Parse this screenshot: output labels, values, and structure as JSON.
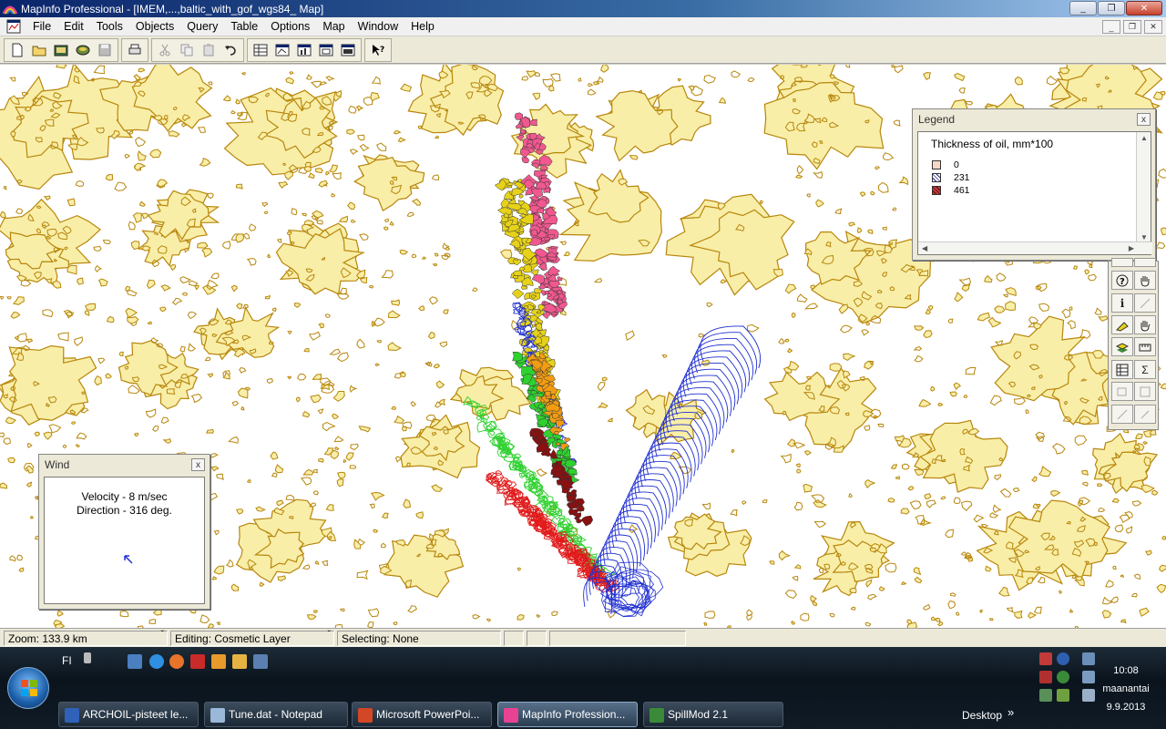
{
  "window": {
    "title": "MapInfo Professional - [IMEM,...,baltic_with_gof_wgs84_ Map]",
    "minimize": "_",
    "restore": "❐",
    "close": "✕"
  },
  "menubar": {
    "items": [
      "File",
      "Edit",
      "Tools",
      "Objects",
      "Query",
      "Table",
      "Options",
      "Map",
      "Window",
      "Help"
    ]
  },
  "toolbar": {
    "icons": [
      "new-icon",
      "open-icon",
      "open-workspace-icon",
      "open-dbms-icon",
      "save-icon",
      "print-icon",
      "cut-icon",
      "copy-icon",
      "paste-icon",
      "undo-icon",
      "new-browser-icon",
      "new-mapper-icon",
      "new-grapher-icon",
      "new-layout-icon",
      "redistrict-icon",
      "help-pointer-icon"
    ]
  },
  "colors": {
    "land": "#f8eea8",
    "coast": "#b8860b",
    "oil_yellow": "#e7d21a",
    "oil_pink": "#f0588f",
    "oil_blue": "#1f2fd0",
    "oil_green": "#2fd12f",
    "oil_red": "#e11b1b",
    "oil_orange": "#f39c12"
  },
  "wind": {
    "title": "Wind",
    "velocity": "Velocity - 8 m/sec",
    "direction": "Direction - 316 deg.",
    "close": "x"
  },
  "legend": {
    "title": "Legend",
    "heading": "Thickness of oil, mm*100",
    "close": "x",
    "entries": [
      {
        "label": "0",
        "color": "#f7d8c8"
      },
      {
        "label": "231",
        "color": "#ffffff"
      },
      {
        "label": "461",
        "color": "#c23a3a"
      }
    ]
  },
  "palette": {
    "icons": [
      "zoom-in-icon",
      "zoom-out-icon",
      "change-view-icon",
      "grabber-icon",
      "info-icon",
      "ruler-icon",
      "label-icon",
      "drag-map-icon",
      "layer-control-icon",
      "scale-bar-icon",
      "statistics-icon",
      "sum-icon",
      "clip-region-icon",
      "set-target-icon",
      "split-icon",
      "erase-icon"
    ],
    "info_glyph": "i",
    "sum_glyph": "Σ"
  },
  "status": {
    "zoom": "Zoom: 133.9 km",
    "editing": "Editing: Cosmetic Layer",
    "selecting": "Selecting: None"
  },
  "taskbar": {
    "lang": "FI",
    "tasks": [
      {
        "label": "ARCHOIL-pisteet le...",
        "color": "#2f62b8"
      },
      {
        "label": "Tune.dat - Notepad",
        "color": "#9ab8d8"
      },
      {
        "label": "Microsoft PowerPoi...",
        "color": "#d24726"
      },
      {
        "label": "MapInfo Profession...",
        "color": "#e84393"
      },
      {
        "label": "SpillMod 2.1",
        "color": "#3a8a3a"
      }
    ],
    "desktop": "Desktop",
    "desktop_chevron": "»",
    "time": "10:08",
    "day": "maanantai",
    "date": "9.9.2013"
  }
}
